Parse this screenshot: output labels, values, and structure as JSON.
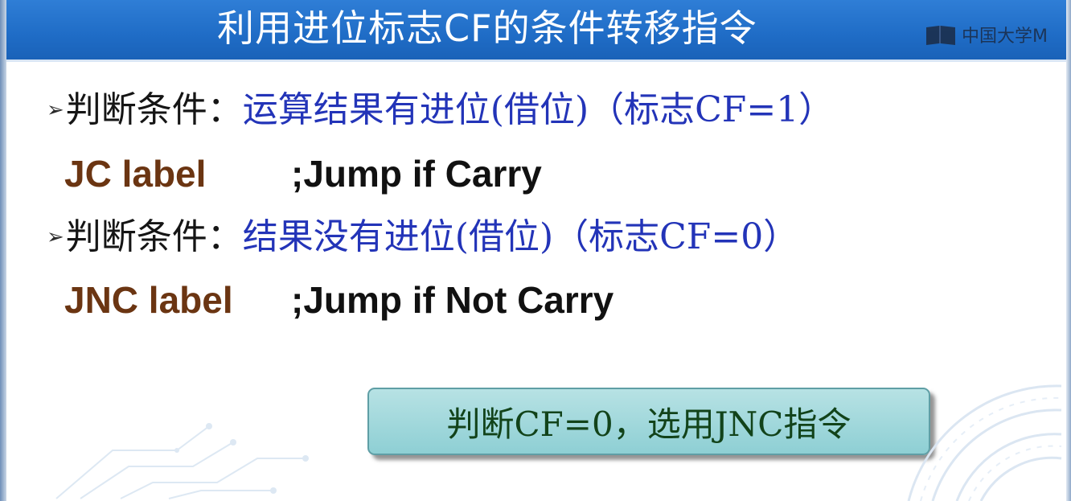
{
  "slide": {
    "title": "利用进位标志CF的条件转移指令",
    "watermark": "中国大学M",
    "watermark_icon": "book-icon",
    "bullet_icon": "arrow-bullet-icon",
    "items": [
      {
        "type": "condition",
        "bullet": "➢",
        "label": "判断条件：",
        "value": "运算结果有进位(借位)（标志CF=1）"
      },
      {
        "type": "instruction",
        "instruction": "JC label",
        "comment": ";Jump if Carry"
      },
      {
        "type": "condition",
        "bullet": "➢",
        "label": "判断条件：",
        "value": "结果没有进位(借位)（标志CF=0）"
      },
      {
        "type": "instruction",
        "instruction": "JNC label",
        "comment": ";Jump if Not Carry"
      }
    ],
    "callout": "判断CF=0，选用JNC指令"
  },
  "colors": {
    "title_bar": "#1f6cc6",
    "title_text": "#ffffff",
    "condition_value": "#2334b8",
    "instruction": "#6b3512",
    "callout_bg": "#a3d9dc",
    "callout_text": "#12431a"
  }
}
